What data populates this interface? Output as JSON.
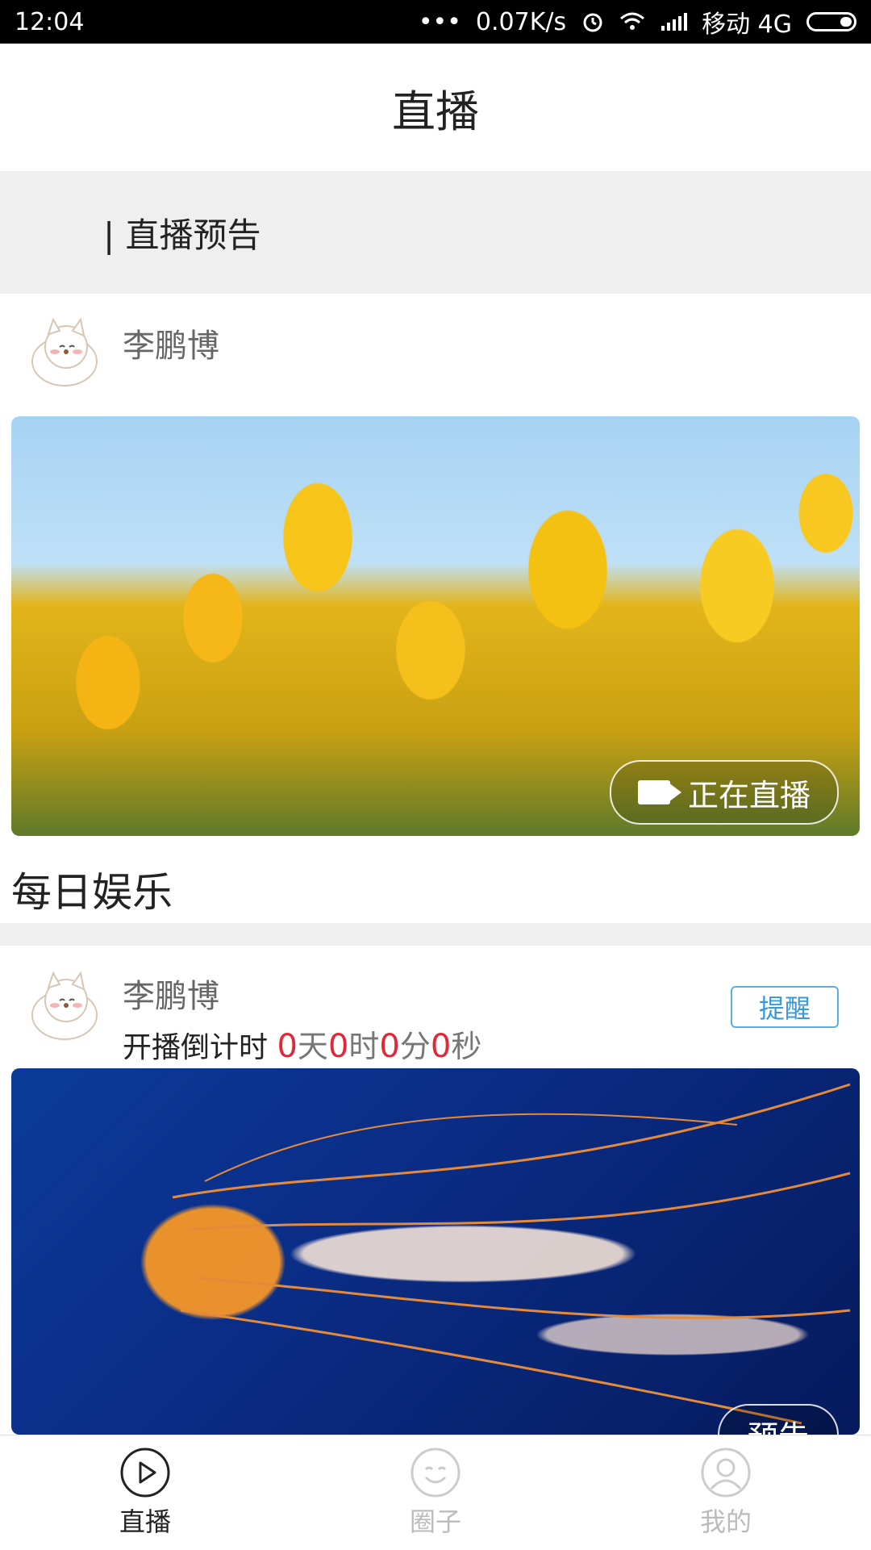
{
  "status_bar": {
    "time": "12:04",
    "dots": "•••",
    "speed": "0.07K/s",
    "carrier": "移动 4G"
  },
  "header": {
    "title": "直播"
  },
  "section": {
    "title": "| 直播预告"
  },
  "cards": [
    {
      "username": "李鹏博",
      "badge_label": "正在直播",
      "title": "每日娱乐"
    },
    {
      "username": "李鹏博",
      "remind_label": "提醒",
      "countdown": {
        "prefix": "开播倒计时",
        "days": "0",
        "days_unit": "天",
        "hours": "0",
        "hours_unit": "时",
        "minutes": "0",
        "minutes_unit": "分",
        "seconds": "0",
        "seconds_unit": "秒"
      },
      "badge_label": "预告"
    }
  ],
  "bottom_nav": {
    "items": [
      {
        "label": "直播",
        "icon": "play-circle-icon",
        "active": true
      },
      {
        "label": "圈子",
        "icon": "smile-face-icon",
        "active": false
      },
      {
        "label": "我的",
        "icon": "user-icon",
        "active": false
      }
    ]
  },
  "colors": {
    "accent_red": "#e0283b",
    "remind_blue": "#3a98d6"
  }
}
